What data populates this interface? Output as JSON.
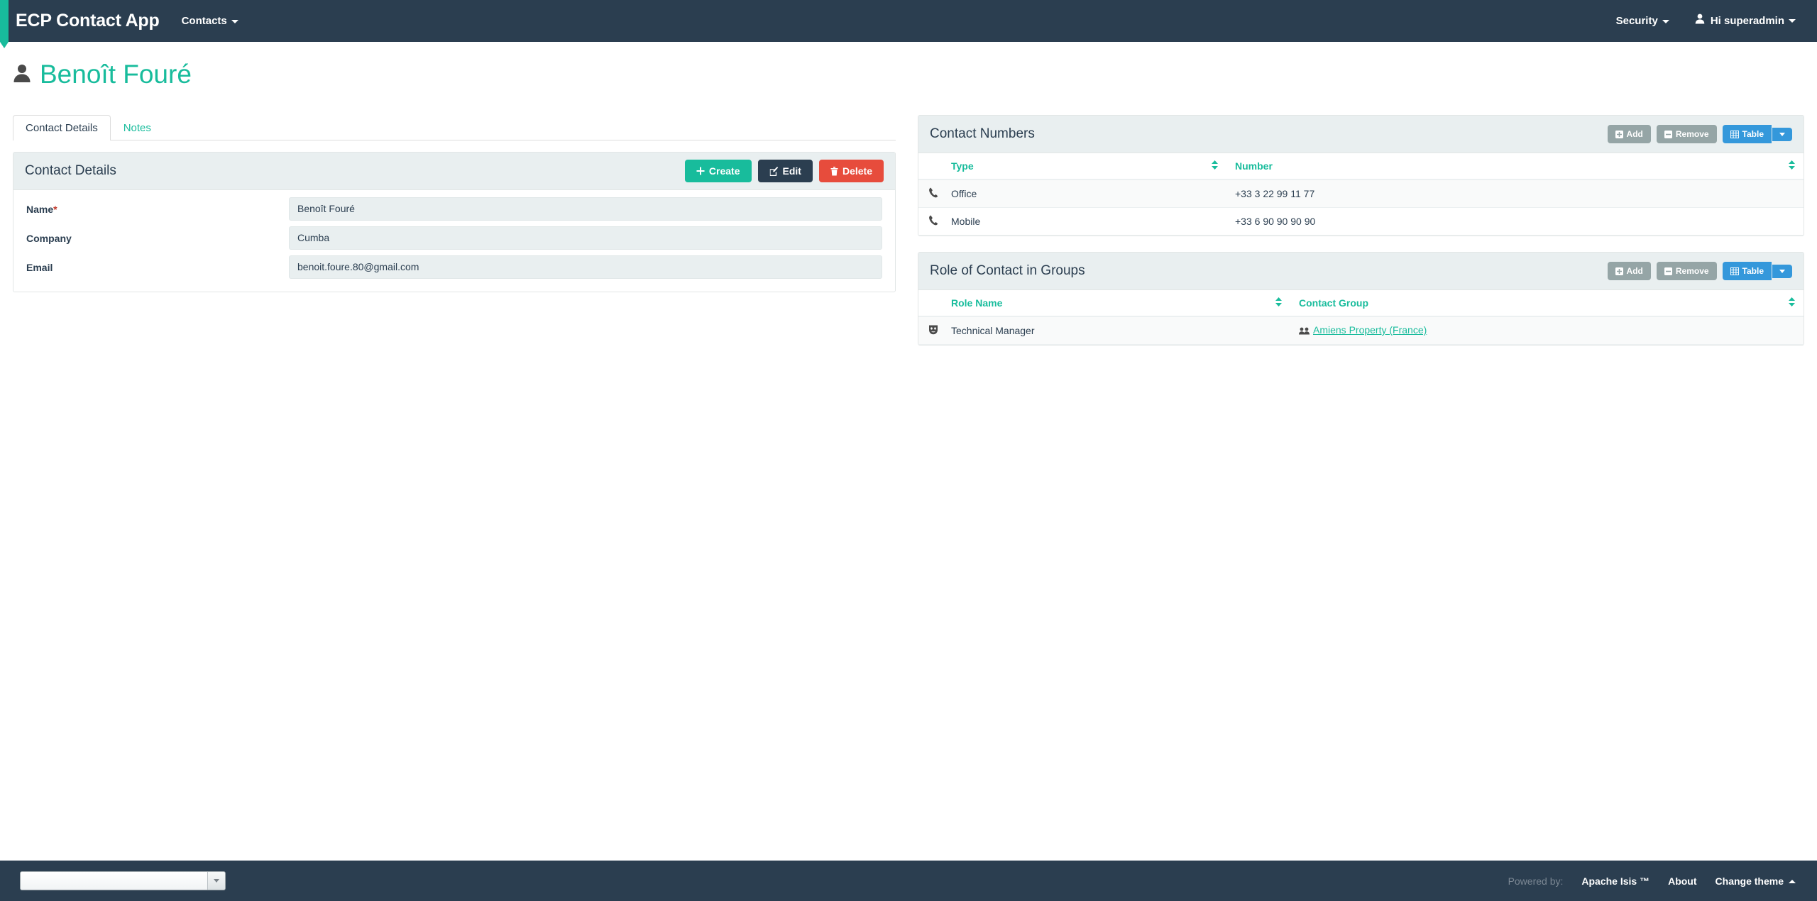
{
  "navbar": {
    "brand": "ECP Contact App",
    "contacts_label": "Contacts",
    "security_label": "Security",
    "user_label": "Hi superadmin",
    "brand_color": "#18BC9C",
    "background_color": "#2B3E50"
  },
  "page": {
    "title": "Benoît Fouré",
    "title_color": "#18BC9C"
  },
  "tabs": [
    {
      "label": "Contact Details",
      "active": true
    },
    {
      "label": "Notes",
      "active": false
    }
  ],
  "contact_details": {
    "panel_title": "Contact Details",
    "buttons": {
      "create": "Create",
      "edit": "Edit",
      "delete": "Delete",
      "create_color": "#18BC9C",
      "edit_color": "#2B3E50",
      "delete_color": "#E74C3C"
    },
    "fields": [
      {
        "label": "Name",
        "required": true,
        "value": "Benoît Fouré"
      },
      {
        "label": "Company",
        "required": false,
        "value": "Cumba"
      },
      {
        "label": "Email",
        "required": false,
        "value": "benoit.foure.80@gmail.com"
      }
    ]
  },
  "contact_numbers": {
    "panel_title": "Contact Numbers",
    "buttons": {
      "add": "Add",
      "remove": "Remove",
      "table": "Table"
    },
    "columns": [
      "Type",
      "Number"
    ],
    "rows": [
      {
        "icon": "phone-icon",
        "type": "Office",
        "number": "+33 3 22 99 11 77"
      },
      {
        "icon": "phone-icon",
        "type": "Mobile",
        "number": "+33 6 90 90 90 90"
      }
    ]
  },
  "roles": {
    "panel_title": "Role of Contact in Groups",
    "buttons": {
      "add": "Add",
      "remove": "Remove",
      "table": "Table"
    },
    "columns": [
      "Role Name",
      "Contact Group"
    ],
    "rows": [
      {
        "icon": "mask-icon",
        "role_name": "Technical Manager",
        "contact_group": "Amiens Property (France)"
      }
    ]
  },
  "footer": {
    "select_value": "",
    "powered_by": "Powered by:",
    "apache_isis": "Apache Isis ™",
    "about": "About",
    "change_theme": "Change theme"
  }
}
